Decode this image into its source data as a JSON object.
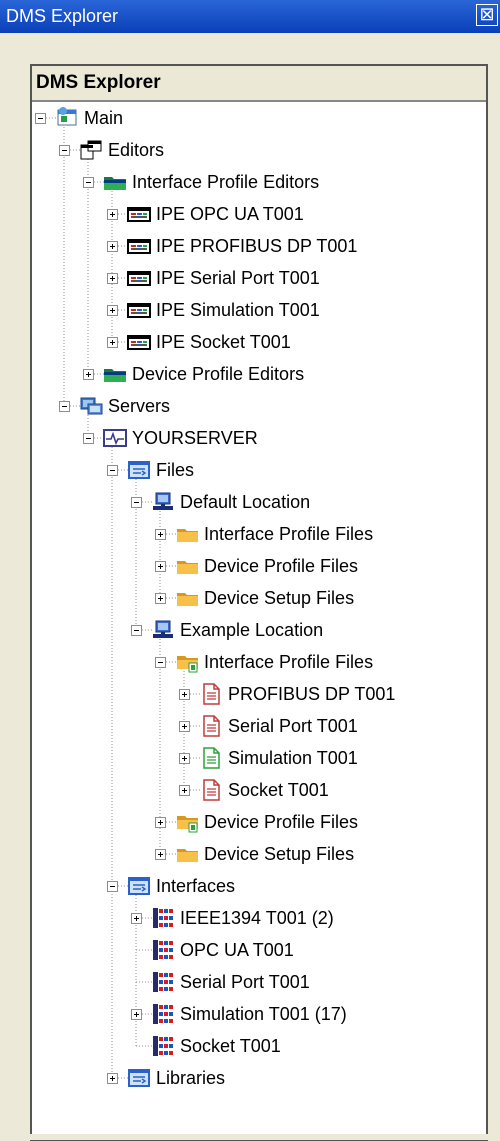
{
  "window": {
    "title": "DMS Explorer",
    "close_glyph": "⊠"
  },
  "tree": {
    "header": "DMS Explorer",
    "nodes": [
      {
        "label": "Main",
        "depth": 0,
        "expander": "minus",
        "icon": "main-icon"
      },
      {
        "label": "Editors",
        "depth": 1,
        "expander": "minus",
        "icon": "editors-icon"
      },
      {
        "label": "Interface Profile Editors",
        "depth": 2,
        "expander": "minus",
        "icon": "folder-green-icon"
      },
      {
        "label": "IPE OPC UA T001",
        "depth": 3,
        "expander": "plus",
        "icon": "editor-window-icon"
      },
      {
        "label": "IPE PROFIBUS DP T001",
        "depth": 3,
        "expander": "plus",
        "icon": "editor-window-icon"
      },
      {
        "label": "IPE Serial Port T001",
        "depth": 3,
        "expander": "plus",
        "icon": "editor-window-icon"
      },
      {
        "label": "IPE Simulation T001",
        "depth": 3,
        "expander": "plus",
        "icon": "editor-window-icon"
      },
      {
        "label": "IPE Socket T001",
        "depth": 3,
        "expander": "plus",
        "icon": "editor-window-icon"
      },
      {
        "label": "Device Profile Editors",
        "depth": 2,
        "expander": "plus",
        "icon": "folder-green-icon"
      },
      {
        "label": "Servers",
        "depth": 1,
        "expander": "minus",
        "icon": "servers-icon"
      },
      {
        "label": "YOURSERVER",
        "depth": 2,
        "expander": "minus",
        "icon": "server-monitor-icon"
      },
      {
        "label": "Files",
        "depth": 3,
        "expander": "minus",
        "icon": "blue-window-icon"
      },
      {
        "label": "Default Location",
        "depth": 4,
        "expander": "minus",
        "icon": "computer-icon"
      },
      {
        "label": "Interface Profile Files",
        "depth": 5,
        "expander": "plus",
        "icon": "folder-icon"
      },
      {
        "label": "Device Profile Files",
        "depth": 5,
        "expander": "plus",
        "icon": "folder-icon"
      },
      {
        "label": "Device Setup Files",
        "depth": 5,
        "expander": "plus",
        "icon": "folder-icon"
      },
      {
        "label": "Example Location",
        "depth": 4,
        "expander": "minus",
        "icon": "computer-icon"
      },
      {
        "label": "Interface Profile Files",
        "depth": 5,
        "expander": "minus",
        "icon": "folder-open-icon"
      },
      {
        "label": "PROFIBUS DP T001",
        "depth": 6,
        "expander": "plus",
        "icon": "document-red-icon"
      },
      {
        "label": "Serial Port T001",
        "depth": 6,
        "expander": "plus",
        "icon": "document-red-icon"
      },
      {
        "label": "Simulation T001",
        "depth": 6,
        "expander": "plus",
        "icon": "document-green-icon"
      },
      {
        "label": "Socket T001",
        "depth": 6,
        "expander": "plus",
        "icon": "document-red-icon"
      },
      {
        "label": "Device Profile Files",
        "depth": 5,
        "expander": "plus",
        "icon": "folder-open-icon"
      },
      {
        "label": "Device Setup Files",
        "depth": 5,
        "expander": "plus",
        "icon": "folder-icon"
      },
      {
        "label": "Interfaces",
        "depth": 3,
        "expander": "minus",
        "icon": "blue-window-icon"
      },
      {
        "label": "IEEE1394 T001 (2)",
        "depth": 4,
        "expander": "plus",
        "icon": "interface-block-icon"
      },
      {
        "label": "OPC UA T001",
        "depth": 4,
        "expander": "none",
        "icon": "interface-block-icon"
      },
      {
        "label": "Serial Port T001",
        "depth": 4,
        "expander": "none",
        "icon": "interface-block-icon"
      },
      {
        "label": "Simulation  T001 (17)",
        "depth": 4,
        "expander": "plus",
        "icon": "interface-block-icon"
      },
      {
        "label": "Socket T001",
        "depth": 4,
        "expander": "none",
        "icon": "interface-block-icon"
      },
      {
        "label": "Libraries",
        "depth": 3,
        "expander": "plus",
        "icon": "blue-window-icon"
      }
    ]
  },
  "colors": {
    "titlebar": "#0a3fb8",
    "panel": "#ece9d8",
    "tree_background": "#ffffff"
  }
}
